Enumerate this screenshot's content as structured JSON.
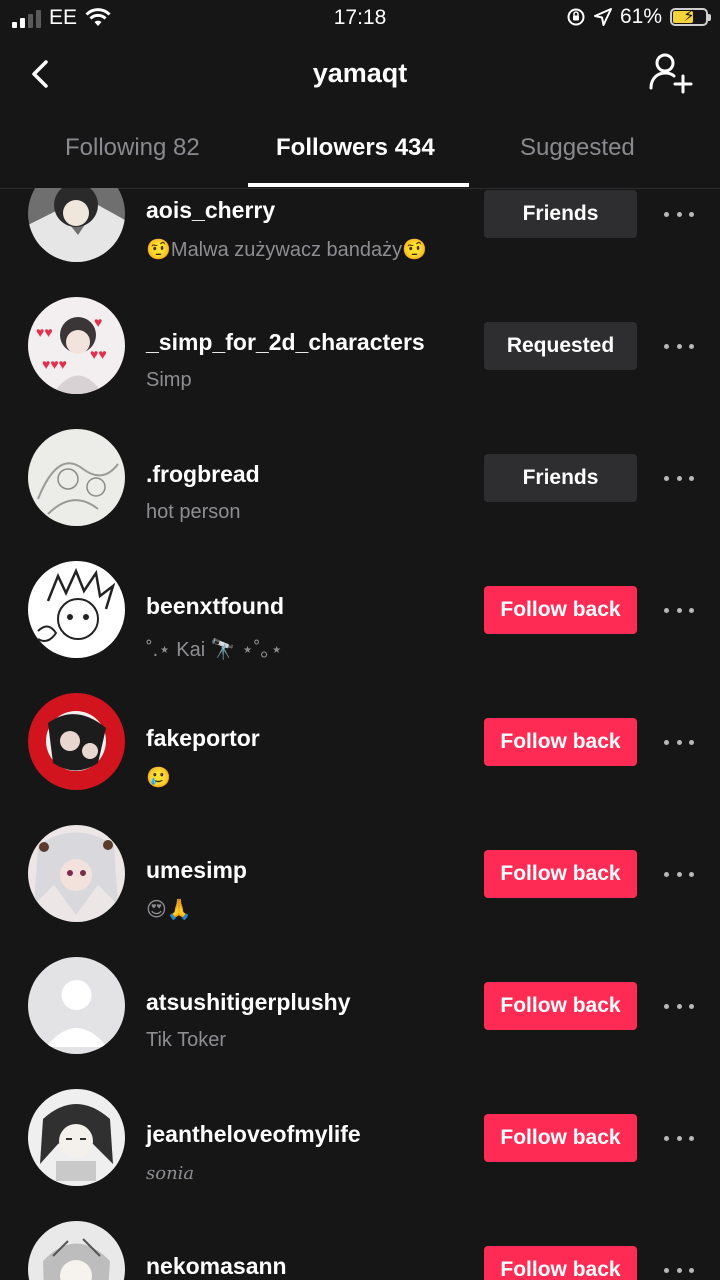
{
  "status_bar": {
    "carrier": "EE",
    "time": "17:18",
    "battery_percent": "61%",
    "battery_level": 0.61
  },
  "header": {
    "title": "yamaqt",
    "back_icon": "chevron-left-icon",
    "add_icon": "add-user-icon"
  },
  "tabs": [
    {
      "label": "Following 82",
      "active": false
    },
    {
      "label": "Followers 434",
      "active": true
    },
    {
      "label": "Suggested",
      "active": false
    }
  ],
  "followers": [
    {
      "username": "aois_cherry",
      "bio": "🤨Malwa zużywacz bandaży🤨",
      "action": "Friends",
      "action_type": "friends",
      "avatar_colors": [
        "#8a8a8a",
        "#e8e8e8"
      ]
    },
    {
      "username": "_simp_for_2d_characters",
      "bio": "Simp",
      "action": "Requested",
      "action_type": "requested",
      "avatar_colors": [
        "#f3eef0",
        "#e0304a"
      ]
    },
    {
      "username": ".frogbread",
      "bio": "hot person",
      "action": "Friends",
      "action_type": "friends",
      "avatar_colors": [
        "#ecece8",
        "#3fae49"
      ]
    },
    {
      "username": "beenxtfound",
      "bio": "˚.⋆ Kai 🔭 ⋆˚｡⋆",
      "action": "Follow back",
      "action_type": "follow",
      "avatar_colors": [
        "#ffffff",
        "#222222"
      ]
    },
    {
      "username": "fakeportor",
      "bio": "🥲",
      "action": "Follow back",
      "action_type": "follow",
      "avatar_colors": [
        "#d2141e",
        "#1c1c1c"
      ]
    },
    {
      "username": "umesimp",
      "bio": "😍🙏",
      "action": "Follow back",
      "action_type": "follow",
      "avatar_colors": [
        "#ece6e6",
        "#7a2b4a"
      ]
    },
    {
      "username": "atsushitigerplushy",
      "bio": "Tik Toker",
      "action": "Follow back",
      "action_type": "follow",
      "avatar_colors": [
        "#e3e3e6",
        "#ffffff"
      ]
    },
    {
      "username": "jeantheloveofmylife",
      "bio": "sonia",
      "action": "Follow back",
      "action_type": "follow",
      "avatar_colors": [
        "#efefef",
        "#303030"
      ]
    },
    {
      "username": "nekomasann",
      "bio": "",
      "action": "Follow back",
      "action_type": "follow",
      "avatar_colors": [
        "#e9e9e9",
        "#555555"
      ]
    }
  ],
  "colors": {
    "background": "#161617",
    "accent": "#fe2c55",
    "secondary_button": "#2e2e30",
    "muted_text": "#8e8e92"
  }
}
